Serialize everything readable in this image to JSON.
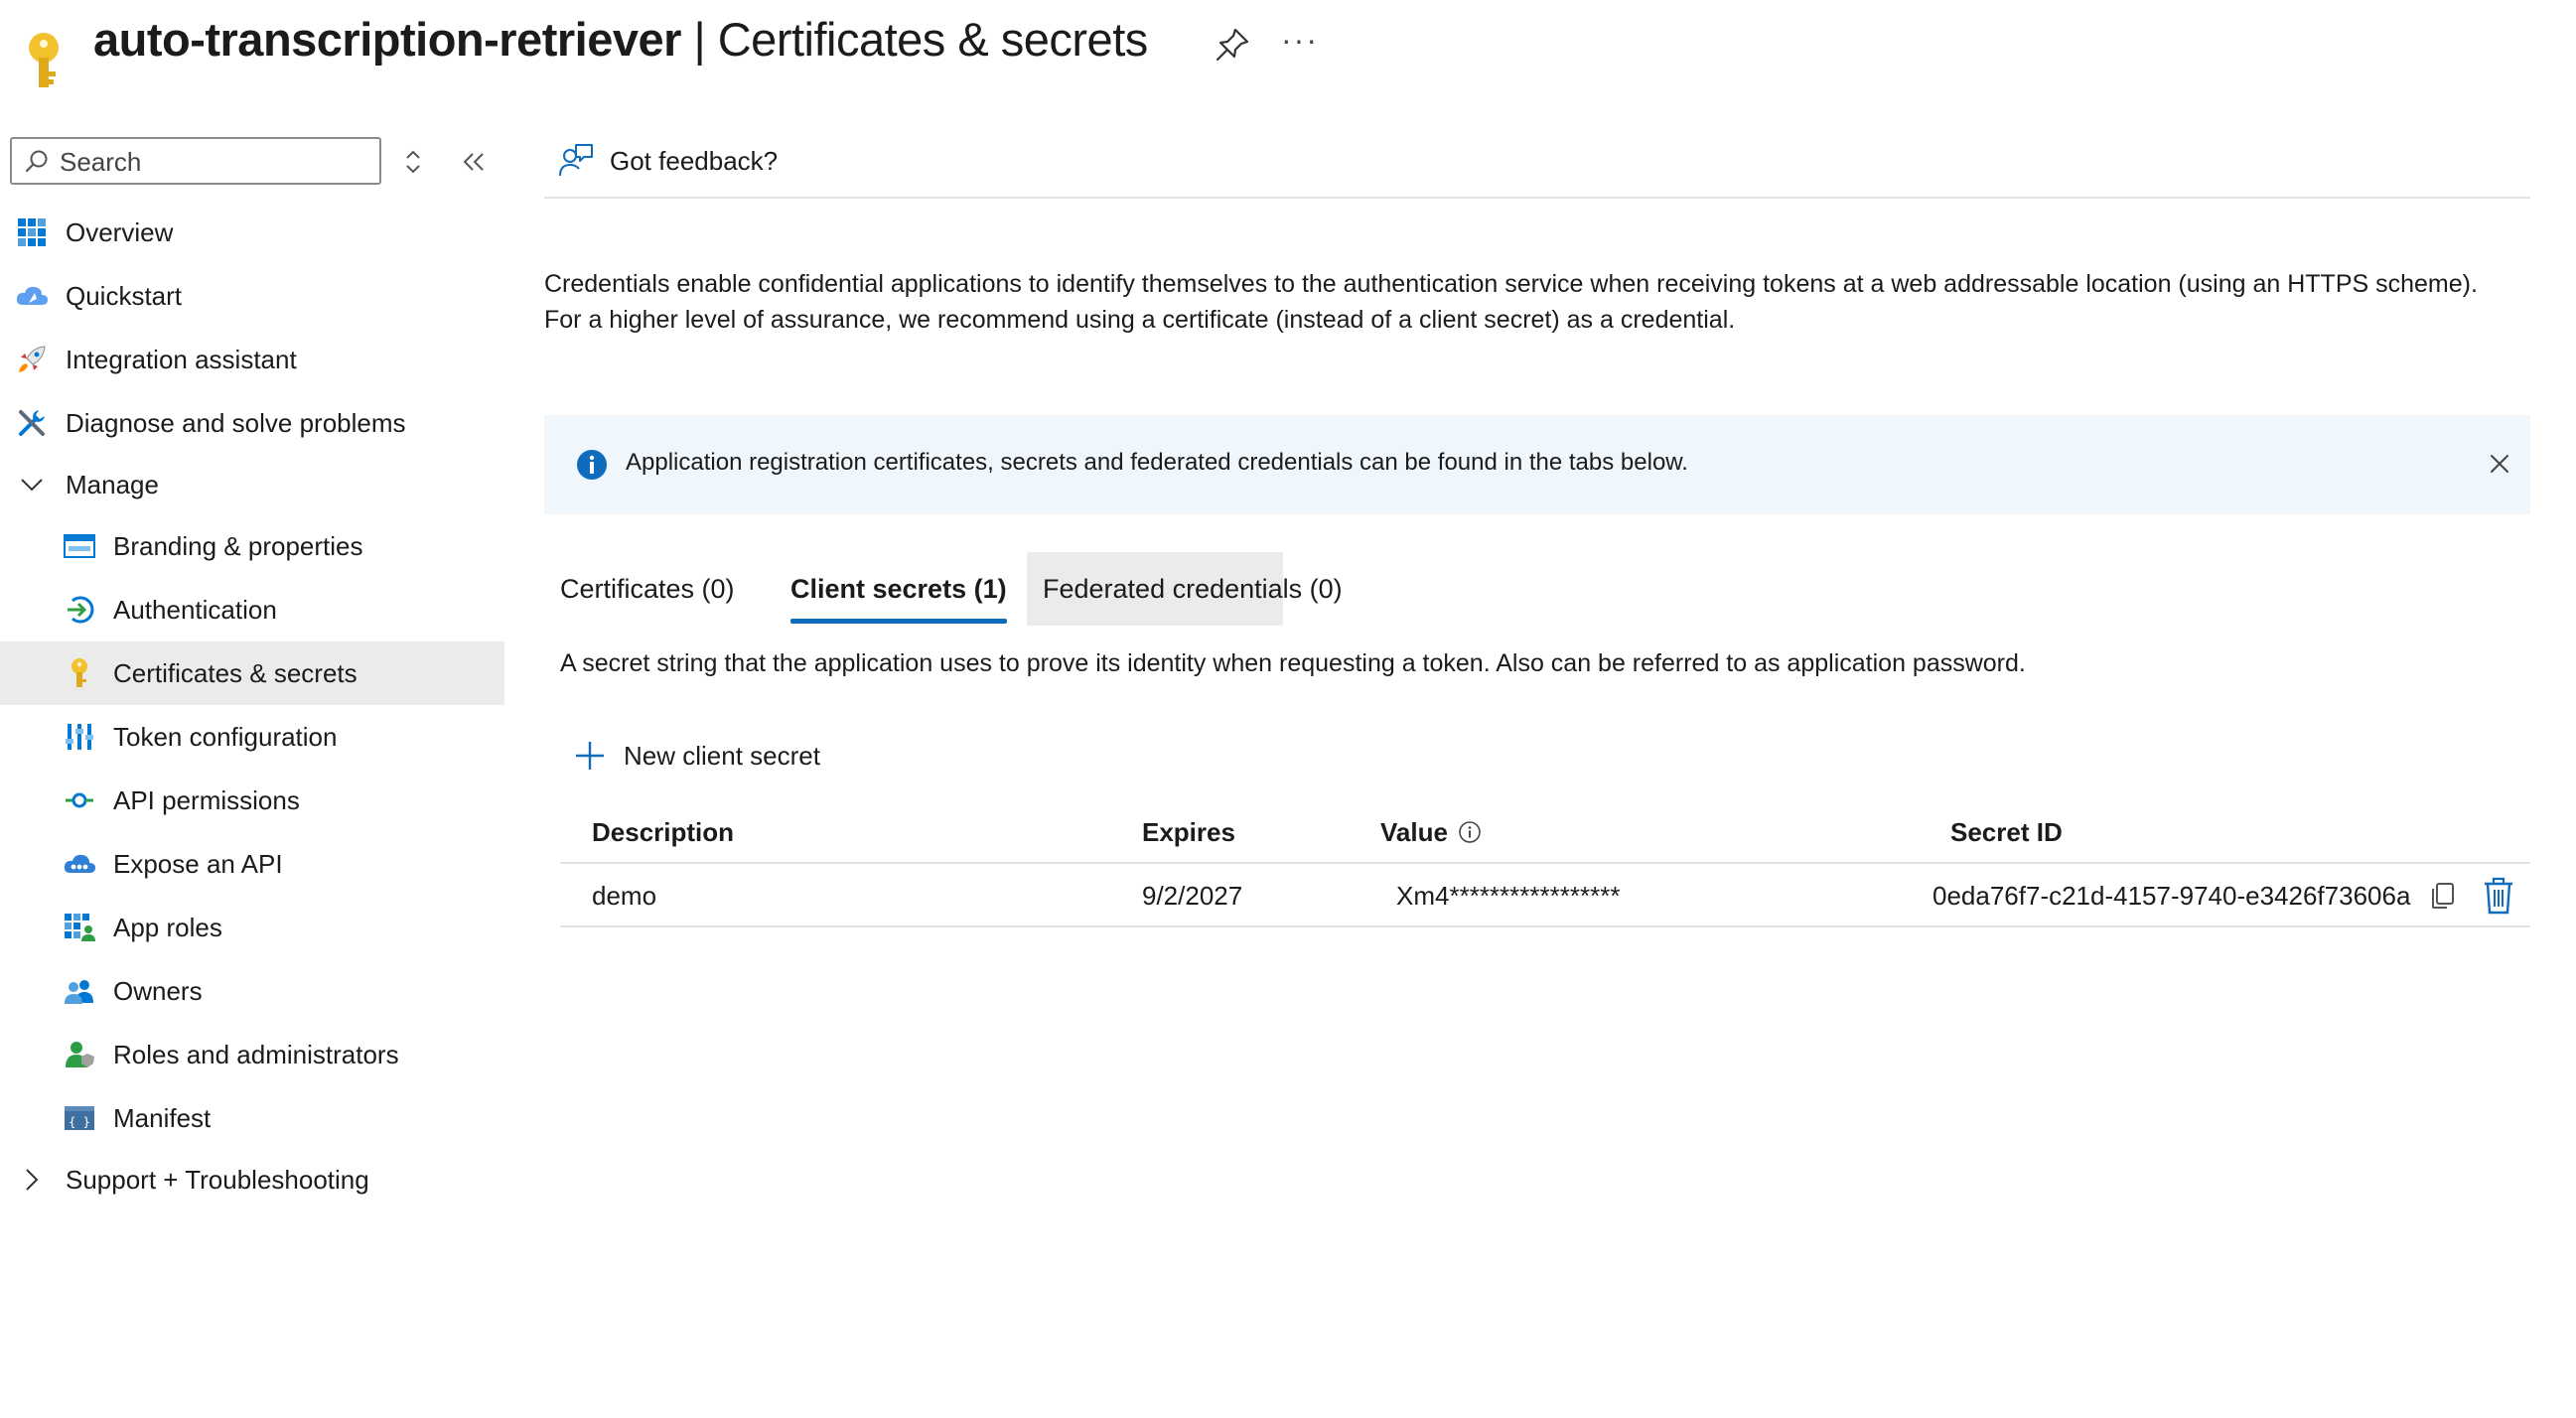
{
  "header": {
    "app_name": "auto-transcription-retriever",
    "separator": " | ",
    "page_title": "Certificates & secrets",
    "icon": "key-icon",
    "pin_icon": "pin-icon",
    "more_label": "···"
  },
  "sidebar": {
    "search_placeholder": "Search",
    "items": [
      {
        "label": "Overview",
        "icon": "overview-grid-icon"
      },
      {
        "label": "Quickstart",
        "icon": "quickstart-cloud-icon"
      },
      {
        "label": "Integration assistant",
        "icon": "rocket-icon"
      },
      {
        "label": "Diagnose and solve problems",
        "icon": "wrench-icon"
      }
    ],
    "manage_group": {
      "label": "Manage",
      "expanded": true,
      "items": [
        {
          "label": "Branding & properties",
          "icon": "branding-icon"
        },
        {
          "label": "Authentication",
          "icon": "authentication-icon"
        },
        {
          "label": "Certificates & secrets",
          "icon": "key-icon",
          "active": true
        },
        {
          "label": "Token configuration",
          "icon": "token-bars-icon"
        },
        {
          "label": "API permissions",
          "icon": "api-permissions-icon"
        },
        {
          "label": "Expose an API",
          "icon": "expose-api-cloud-icon"
        },
        {
          "label": "App roles",
          "icon": "app-roles-icon"
        },
        {
          "label": "Owners",
          "icon": "owners-icon"
        },
        {
          "label": "Roles and administrators",
          "icon": "roles-admin-icon"
        },
        {
          "label": "Manifest",
          "icon": "manifest-icon"
        }
      ]
    },
    "support_group": {
      "label": "Support + Troubleshooting",
      "expanded": false
    }
  },
  "toolbar": {
    "feedback_label": "Got feedback?"
  },
  "main": {
    "description": "Credentials enable confidential applications to identify themselves to the authentication service when receiving tokens at a web addressable location (using an HTTPS scheme). For a higher level of assurance, we recommend using a certificate (instead of a client secret) as a credential.",
    "info_banner": "Application registration certificates, secrets and federated credentials can be found in the tabs below.",
    "tabs": [
      {
        "label": "Certificates (0)",
        "selected": false
      },
      {
        "label": "Client secrets (1)",
        "selected": true
      },
      {
        "label": "Federated credentials (0)",
        "selected": false
      }
    ],
    "tab_description": "A secret string that the application uses to prove its identity when requesting a token. Also can be referred to as application password.",
    "new_secret_label": "New client secret",
    "table": {
      "columns": [
        "Description",
        "Expires",
        "Value",
        "Secret ID"
      ],
      "rows": [
        {
          "description": "demo",
          "expires": "9/2/2027",
          "value": "Xm4*****************",
          "secret_id": "0eda76f7-c21d-4157-9740-e3426f73606a"
        }
      ]
    }
  },
  "colors": {
    "accent": "#0f6cbd",
    "banner_bg": "#eff6fc",
    "active_nav_bg": "#ebebeb",
    "key_yellow": "#f2c12e"
  }
}
